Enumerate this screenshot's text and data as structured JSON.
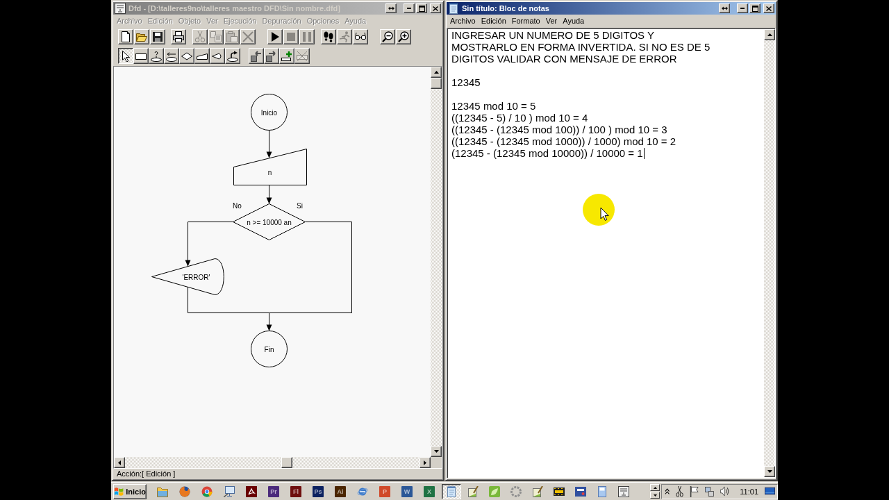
{
  "dfd_window": {
    "title": "Dfd - [D:\\talleres9no\\talleres maestro DFD\\Sin nombre.dfd]",
    "active": false,
    "menu": [
      {
        "label": "Archivo",
        "disabled": true
      },
      {
        "label": "Edición",
        "disabled": true
      },
      {
        "label": "Objeto",
        "disabled": true
      },
      {
        "label": "Ver",
        "disabled": true
      },
      {
        "label": "Ejecución",
        "disabled": true
      },
      {
        "label": "Depuración",
        "disabled": true
      },
      {
        "label": "Opciones",
        "disabled": true
      },
      {
        "label": "Ayuda",
        "disabled": true
      }
    ],
    "toolbar_1": [
      [
        {
          "disabled": false
        },
        {
          "disabled": false
        },
        {
          "disabled": false
        }
      ],
      [
        {
          "disabled": false
        }
      ],
      [
        {
          "disabled": true
        },
        {
          "disabled": true
        },
        {
          "disabled": true
        },
        {
          "disabled": true
        }
      ],
      [
        {
          "disabled": false
        },
        {
          "disabled": true
        },
        {
          "disabled": true
        }
      ],
      [
        {
          "disabled": false
        },
        {
          "disabled": true
        },
        {
          "disabled": false
        }
      ],
      [
        {
          "disabled": false
        },
        {
          "disabled": false
        }
      ]
    ],
    "toolbar_2": {
      "tools": [
        {
          "selected": true
        },
        {
          "selected": false
        },
        {
          "selected": false
        },
        {
          "selected": false
        },
        {
          "selected": false
        },
        {
          "selected": false
        },
        {
          "selected": false
        },
        {
          "selected": false
        }
      ],
      "actions": [
        {
          "disabled": false
        },
        {
          "disabled": false
        },
        {
          "disabled": false
        },
        {
          "disabled": true
        }
      ]
    },
    "flowchart": {
      "nodes": [
        {
          "kind": "terminal",
          "text": "Inicio"
        },
        {
          "kind": "input",
          "text": "n"
        },
        {
          "kind": "decision",
          "text": "n >= 10000 an",
          "branch_labels": [
            "No",
            "Si"
          ]
        },
        {
          "kind": "output",
          "text": "'ERROR'"
        },
        {
          "kind": "terminal",
          "text": "Fin"
        }
      ]
    },
    "status_bar": "Acción:[ Edición ]"
  },
  "notepad_window": {
    "title": "Sin título: Bloc de notas",
    "active": true,
    "menu": [
      {
        "label": "Archivo",
        "disabled": false
      },
      {
        "label": "Edición",
        "disabled": false
      },
      {
        "label": "Formato",
        "disabled": false
      },
      {
        "label": "Ver",
        "disabled": false
      },
      {
        "label": "Ayuda",
        "disabled": false
      }
    ],
    "text_blocks": [
      [
        "INGRESAR UN NUMERO DE 5 DIGITOS Y",
        "MOSTRARLO EN FORMA INVERTIDA. SI NO ES DE 5",
        "DIGITOS VALIDAR CON MENSAJE DE ERROR"
      ],
      [
        "12345"
      ],
      [
        "12345 mod 10 = 5",
        "((12345 - 5) / 10 ) mod 10 = 4",
        "((12345 - (12345 mod 100)) / 100 ) mod 10 = 3",
        "((12345 - (12345 mod 1000)) / 1000) mod 10 = 2",
        "(12345 - (12345 mod 10000)) / 10000 = 1"
      ]
    ]
  },
  "taskbar": {
    "start_button": "Inicio",
    "app_tiles": [
      {
        "text": "Pr",
        "color": "#4b2a7b"
      },
      {
        "text": "Fl",
        "color": "#6e0e0e"
      },
      {
        "text": "Ps",
        "color": "#0b2160"
      },
      {
        "text": "Ai",
        "color": "#4a2500"
      },
      {
        "text": "P",
        "color": "#d04a2a"
      },
      {
        "text": "W",
        "color": "#2b5797"
      },
      {
        "text": "X",
        "color": "#1f7244"
      }
    ],
    "window_buttons": [
      {
        "selected": true
      },
      {
        "selected": false
      },
      {
        "selected": false
      },
      {
        "selected": false
      },
      {
        "selected": false
      },
      {
        "selected": false
      },
      {
        "selected": false
      },
      {
        "selected": false
      },
      {
        "selected": false
      }
    ],
    "clock": "11:01"
  }
}
